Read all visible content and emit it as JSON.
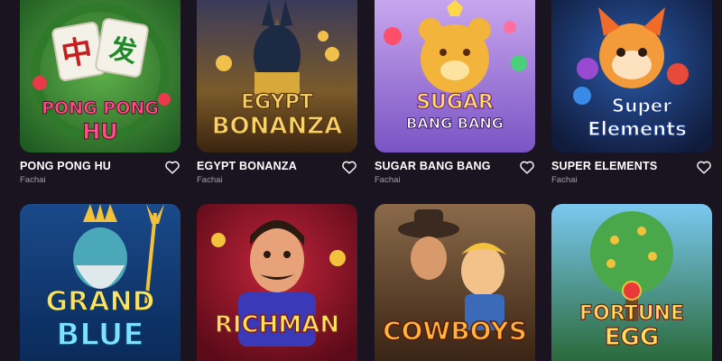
{
  "games": [
    {
      "title": "PONG PONG HU",
      "provider": "Fachai",
      "art_text": [
        "PONG PONG",
        "HU"
      ],
      "art_glyphs": [
        "中",
        "发"
      ]
    },
    {
      "title": "EGYPT BONANZA",
      "provider": "Fachai",
      "art_text": [
        "EGYPT",
        "BONANZA"
      ]
    },
    {
      "title": "SUGAR BANG BANG",
      "provider": "Fachai",
      "art_text": [
        "SUGAR",
        "BANG BANG"
      ]
    },
    {
      "title": "SUPER ELEMENTS",
      "provider": "Fachai",
      "art_text": [
        "Super",
        "Elements"
      ]
    },
    {
      "title": "",
      "provider": "",
      "art_text": [
        "GRAND",
        "BLUE"
      ]
    },
    {
      "title": "",
      "provider": "",
      "art_text": [
        "RICHMAN"
      ]
    },
    {
      "title": "",
      "provider": "",
      "art_text": [
        "COWBOYS"
      ]
    },
    {
      "title": "",
      "provider": "",
      "art_text": [
        "FORTUNE",
        "EGG"
      ]
    }
  ],
  "icons": {
    "favorite": "heart-outline-icon"
  },
  "colors": {
    "background": "#1a1420",
    "title": "#ffffff",
    "provider": "#a49cab"
  }
}
